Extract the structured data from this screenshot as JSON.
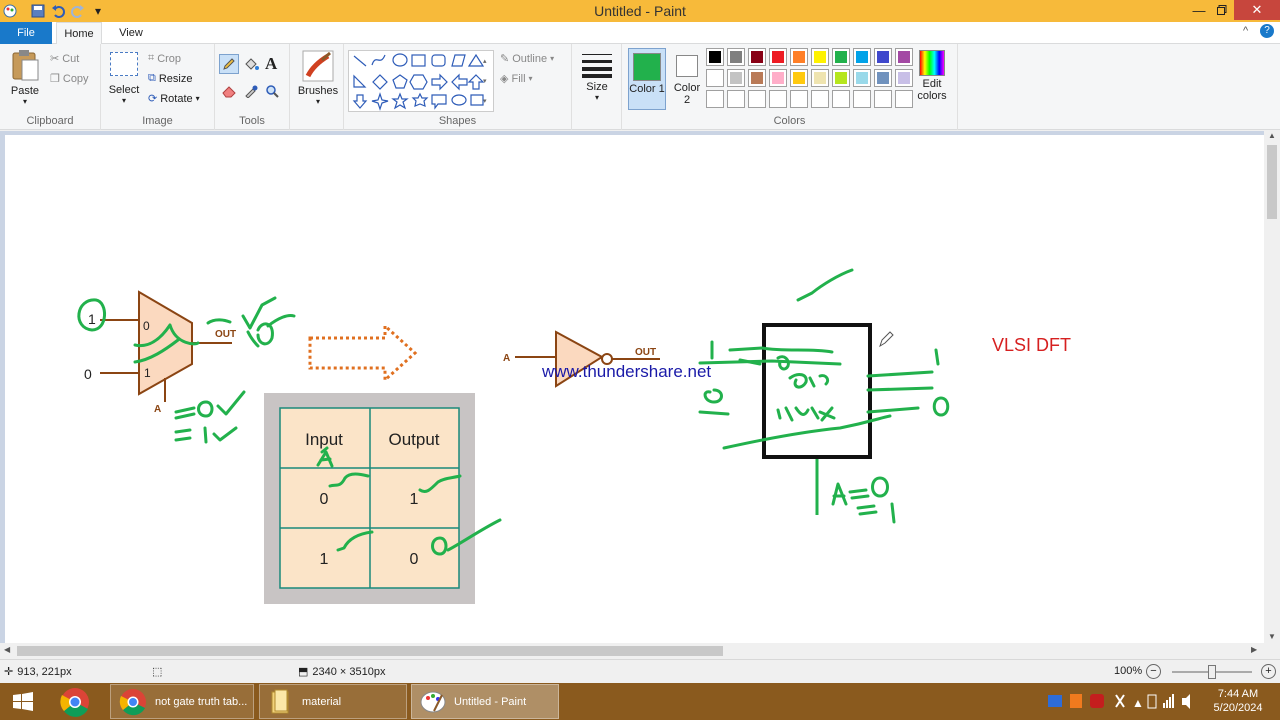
{
  "window": {
    "title": "Untitled - Paint"
  },
  "tabs": [
    {
      "label": "File"
    },
    {
      "label": "Home"
    },
    {
      "label": "View"
    }
  ],
  "ribbon": {
    "clipboard": {
      "label": "Clipboard",
      "paste": "Paste",
      "cut": "Cut",
      "copy": "Copy"
    },
    "image": {
      "label": "Image",
      "select": "Select",
      "crop": "Crop",
      "resize": "Resize",
      "rotate": "Rotate"
    },
    "tools": {
      "label": "Tools"
    },
    "brushes": {
      "label": "Brushes"
    },
    "shapes": {
      "label": "Shapes",
      "outline": "Outline",
      "fill": "Fill"
    },
    "size": {
      "label": "Size"
    },
    "colors": {
      "label": "Colors",
      "color1": "Color 1",
      "color2": "Color 2",
      "color1_value": "#22b14c",
      "color2_value": "#ffffff",
      "edit": "Edit colors",
      "palette_row1": [
        "#000000",
        "#7f7f7f",
        "#880015",
        "#ed1c24",
        "#ff7f27",
        "#fff200",
        "#22b14c",
        "#00a2e8",
        "#3f48cc",
        "#a349a4"
      ],
      "palette_row2": [
        "#ffffff",
        "#c3c3c3",
        "#b97a57",
        "#ffaec9",
        "#ffc90e",
        "#efe4b0",
        "#b5e61d",
        "#99d9ea",
        "#7092be",
        "#c8bfe7"
      ],
      "palette_row3": [
        "#ffffff",
        "#ffffff",
        "#ffffff",
        "#ffffff",
        "#ffffff",
        "#ffffff",
        "#ffffff",
        "#ffffff",
        "#ffffff",
        "#ffffff"
      ]
    }
  },
  "canvas": {
    "mux_left": {
      "in1": "1",
      "in0": "0",
      "sel0": "0",
      "sel1": "1",
      "out": "OUT",
      "select": "A"
    },
    "not_gate": {
      "input": "A",
      "out": "OUT"
    },
    "watermark": "www.thundershare.net",
    "truth_table": {
      "headers": [
        "Input",
        "Output"
      ],
      "rows": [
        [
          "0",
          "1"
        ],
        [
          "1",
          "0"
        ]
      ]
    },
    "title_text": "VLSI DFT"
  },
  "status": {
    "cursor_pos": "913, 221px",
    "image_size": "2340 × 3510px",
    "zoom": "100%"
  },
  "taskbar": {
    "items": [
      {
        "label": "not gate truth tab..."
      },
      {
        "label": "material"
      },
      {
        "label": "Untitled - Paint"
      }
    ],
    "time": "7:44 AM",
    "date": "5/20/2024"
  }
}
